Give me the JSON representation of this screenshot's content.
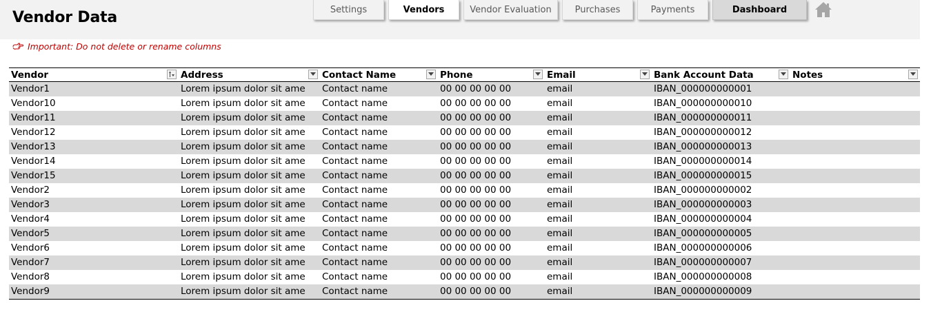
{
  "page": {
    "title": "Vendor Data",
    "warning": "Important: Do not delete or rename columns"
  },
  "nav": {
    "tabs": [
      {
        "label": "Settings",
        "state": "normal"
      },
      {
        "label": "Vendors",
        "state": "active"
      },
      {
        "label": "Vendor Evaluation",
        "state": "normal"
      },
      {
        "label": "Purchases",
        "state": "normal"
      },
      {
        "label": "Payments",
        "state": "normal"
      },
      {
        "label": "Dashboard",
        "state": "dashboard"
      }
    ],
    "home_icon": "home-icon"
  },
  "colors": {
    "band": "#f2f2f2",
    "row_shade": "#d9d9d9",
    "warning": "#c00000",
    "home_icon": "#a6a6a6"
  },
  "table": {
    "columns": [
      "Vendor",
      "Address",
      "Contact Name",
      "Phone",
      "Email",
      "Bank Account Data",
      "Notes"
    ],
    "sorted_column": "Vendor",
    "rows": [
      [
        "Vendor1",
        "Lorem ipsum dolor sit ame",
        "Contact name",
        "00 00 00 00 00",
        "email",
        "IBAN_000000000001",
        ""
      ],
      [
        "Vendor10",
        "Lorem ipsum dolor sit ame",
        "Contact name",
        "00 00 00 00 00",
        "email",
        "IBAN_000000000010",
        ""
      ],
      [
        "Vendor11",
        "Lorem ipsum dolor sit ame",
        "Contact name",
        "00 00 00 00 00",
        "email",
        "IBAN_000000000011",
        ""
      ],
      [
        "Vendor12",
        "Lorem ipsum dolor sit ame",
        "Contact name",
        "00 00 00 00 00",
        "email",
        "IBAN_000000000012",
        ""
      ],
      [
        "Vendor13",
        "Lorem ipsum dolor sit ame",
        "Contact name",
        "00 00 00 00 00",
        "email",
        "IBAN_000000000013",
        ""
      ],
      [
        "Vendor14",
        "Lorem ipsum dolor sit ame",
        "Contact name",
        "00 00 00 00 00",
        "email",
        "IBAN_000000000014",
        ""
      ],
      [
        "Vendor15",
        "Lorem ipsum dolor sit ame",
        "Contact name",
        "00 00 00 00 00",
        "email",
        "IBAN_000000000015",
        ""
      ],
      [
        "Vendor2",
        "Lorem ipsum dolor sit ame",
        "Contact name",
        "00 00 00 00 00",
        "email",
        "IBAN_000000000002",
        ""
      ],
      [
        "Vendor3",
        "Lorem ipsum dolor sit ame",
        "Contact name",
        "00 00 00 00 00",
        "email",
        "IBAN_000000000003",
        ""
      ],
      [
        "Vendor4",
        "Lorem ipsum dolor sit ame",
        "Contact name",
        "00 00 00 00 00",
        "email",
        "IBAN_000000000004",
        ""
      ],
      [
        "Vendor5",
        "Lorem ipsum dolor sit ame",
        "Contact name",
        "00 00 00 00 00",
        "email",
        "IBAN_000000000005",
        ""
      ],
      [
        "Vendor6",
        "Lorem ipsum dolor sit ame",
        "Contact name",
        "00 00 00 00 00",
        "email",
        "IBAN_000000000006",
        ""
      ],
      [
        "Vendor7",
        "Lorem ipsum dolor sit ame",
        "Contact name",
        "00 00 00 00 00",
        "email",
        "IBAN_000000000007",
        ""
      ],
      [
        "Vendor8",
        "Lorem ipsum dolor sit ame",
        "Contact name",
        "00 00 00 00 00",
        "email",
        "IBAN_000000000008",
        ""
      ],
      [
        "Vendor9",
        "Lorem ipsum dolor sit ame",
        "Contact name",
        "00 00 00 00 00",
        "email",
        "IBAN_000000000009",
        ""
      ]
    ]
  }
}
